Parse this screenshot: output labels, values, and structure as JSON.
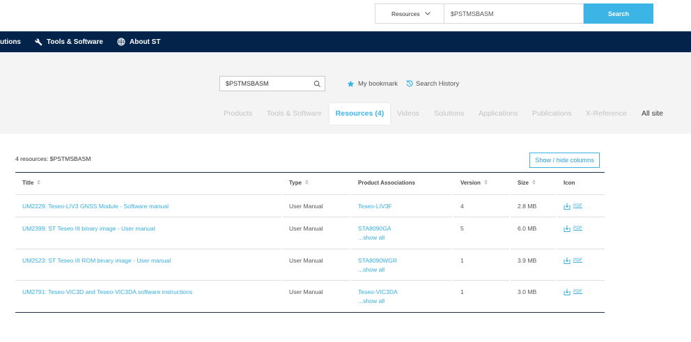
{
  "colors": {
    "accent": "#3cb4e6",
    "navy": "#03234b",
    "panel": "#f4f4f4"
  },
  "top_search": {
    "scope": "Resources",
    "scope_icon": "chevron-down-icon",
    "query": "$PSTMSBASM",
    "button": "Search"
  },
  "navbar": {
    "items": [
      {
        "label": "utions"
      },
      {
        "label": "Tools & Software",
        "icon": "wrench-icon"
      },
      {
        "label": "About ST",
        "icon": "globe-icon"
      }
    ]
  },
  "search_panel": {
    "query": "$PSTMSBASM",
    "search_icon": "search-icon",
    "bookmark": {
      "label": "My bookmark",
      "icon": "star-icon"
    },
    "history": {
      "label": "Search History",
      "icon": "history-icon"
    },
    "tabs": [
      {
        "label": "Products"
      },
      {
        "label": "Tools & Software"
      },
      {
        "label": "Resources (4)",
        "active": true
      },
      {
        "label": "Videos"
      },
      {
        "label": "Solutions"
      },
      {
        "label": "Applications"
      },
      {
        "label": "Publications"
      },
      {
        "label": "X-Reference"
      },
      {
        "label": "All site"
      }
    ]
  },
  "results": {
    "summary": "4 resources: $PSTMSBASM",
    "columns_button": "Show / hide columns",
    "columns": [
      {
        "label": "Title",
        "sortable": true
      },
      {
        "label": "Type",
        "sortable": true
      },
      {
        "label": "Product Associations",
        "sortable": false
      },
      {
        "label": "Version",
        "sortable": true
      },
      {
        "label": "Size",
        "sortable": true
      },
      {
        "label": "Icon",
        "sortable": false
      }
    ],
    "rows": [
      {
        "title": "UM2229: Teseo-LIV3 GNSS Module - Software manual",
        "type": "User Manual",
        "product": "Teseo-LIV3F",
        "version": "4",
        "size": "2.8 MB",
        "file_icon": "download-icon",
        "file_type": "PDF"
      },
      {
        "title": "UM2399: ST Teseo III binary image - User manual",
        "type": "User Manual",
        "product": "STA8090GA",
        "show_all": "...show all",
        "version": "5",
        "size": "6.0 MB",
        "file_icon": "download-icon",
        "file_type": "PDF"
      },
      {
        "title": "UM2523: ST Teseo III ROM binary image - User manual",
        "type": "User Manual",
        "product": "STA8090WGR",
        "show_all": "...show all",
        "version": "1",
        "size": "3.9 MB",
        "file_icon": "download-icon",
        "file_type": "PDF"
      },
      {
        "title": "UM2791: Teseo-VIC3D and Teseo-VIC3DA software instructions",
        "type": "User Manual",
        "product": "Teseo-VIC3DA",
        "show_all": "...show all",
        "version": "1",
        "size": "3.0 MB",
        "file_icon": "download-icon",
        "file_type": "PDF"
      }
    ]
  }
}
